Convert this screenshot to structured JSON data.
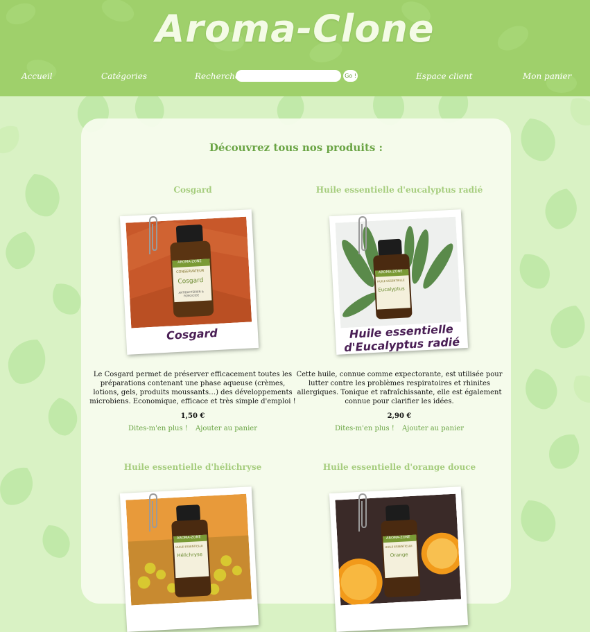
{
  "header": {
    "logo": "Aroma-Clone",
    "nav": {
      "home": "Accueil",
      "categories": "Catégories",
      "search_label": "Rechercher :",
      "search_value": "",
      "go_label": "Go !",
      "account": "Espace client",
      "cart": "Mon panier"
    }
  },
  "main": {
    "title": "Découvrez tous nos produits :",
    "products": [
      {
        "name": "Cosgard",
        "caption": "Cosgard",
        "bottle_brand": "AROMA-ZONE",
        "bottle_type": "CONSERVATEUR",
        "bottle_label": "Cosgard",
        "bottle_sub": "ANTIBACTÉRIEN & FONGICIDE",
        "description": "Le Cosgard permet de préserver efficacement toutes les préparations contenant une phase aqueuse (crèmes, lotions, gels, produits moussants…) des développements microbiens. Economique, efficace et très simple d'emploi !",
        "price": "1,50 €",
        "more_label": "Dites-m'en plus !",
        "cart_label": "Ajouter au panier"
      },
      {
        "name": "Huile essentielle d'eucalyptus radié",
        "caption_line1": "Huile essentielle",
        "caption_line2": "d'Eucalyptus radié",
        "bottle_brand": "AROMA-ZONE",
        "bottle_type": "HUILE ESSENTIELLE",
        "bottle_label": "Eucalyptus",
        "description": "Cette huile, connue comme expectorante, est utilisée pour lutter contre les problèmes respiratoires et rhinites allergiques. Tonique et rafraîchissante, elle est également connue pour clarifier les idées.",
        "price": "2,90 €",
        "more_label": "Dites-m'en plus !",
        "cart_label": "Ajouter au panier"
      },
      {
        "name": "Huile essentielle d'hélichryse",
        "bottle_brand": "AROMA-ZONE",
        "bottle_type": "HUILE ESSENTIELLE",
        "bottle_label": "Hélichryse"
      },
      {
        "name": "Huile essentielle d'orange douce",
        "bottle_brand": "AROMA-ZONE",
        "bottle_type": "HUILE ESSENTIELLE",
        "bottle_label": "Orange"
      }
    ]
  },
  "colors": {
    "header_bg": "#9fd06b",
    "page_bg": "#d9f2c4",
    "accent_green": "#6aa444",
    "product_title": "#a6cd7e",
    "caption_purple": "#4a1f55"
  }
}
